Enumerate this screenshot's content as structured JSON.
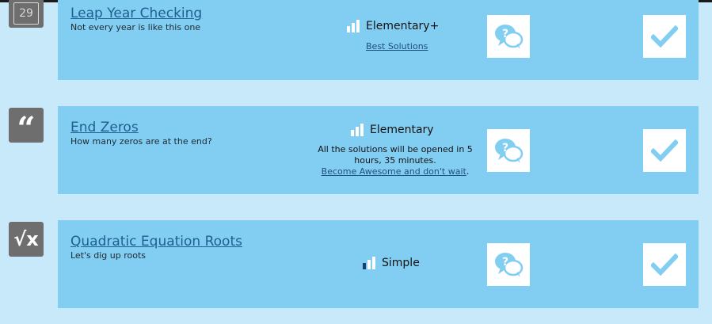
{
  "tasks": [
    {
      "title": "Leap Year Checking",
      "description": "Not every year is like this one",
      "side_icon": "calendar-29-icon",
      "side_icon_text": "29",
      "level": "Elementary+",
      "level_bars_filled": 3,
      "link": "Best Solutions"
    },
    {
      "title": "End Zeros",
      "description": "How many zeros are at the end?",
      "side_icon": "quote-icon",
      "side_icon_text": "“",
      "level": "Elementary",
      "level_bars_filled": 3,
      "notice_text": "All the solutions will be opened in 5 hours, 35 minutes.",
      "notice_link": "Become Awesome and don't wait",
      "notice_tail": "."
    },
    {
      "title": "Quadratic Equation Roots",
      "description": "Let's dig up roots",
      "side_icon": "sqrt-x-icon",
      "side_icon_text": "√x",
      "level": "Simple",
      "level_bars_filled": 1
    }
  ],
  "colors": {
    "page_bg": "#c8e9fa",
    "card_bg": "#82cef3",
    "side_icon_bg": "#6e6e6e",
    "accent": "#82cef3",
    "title_link": "#1f5f8f"
  }
}
